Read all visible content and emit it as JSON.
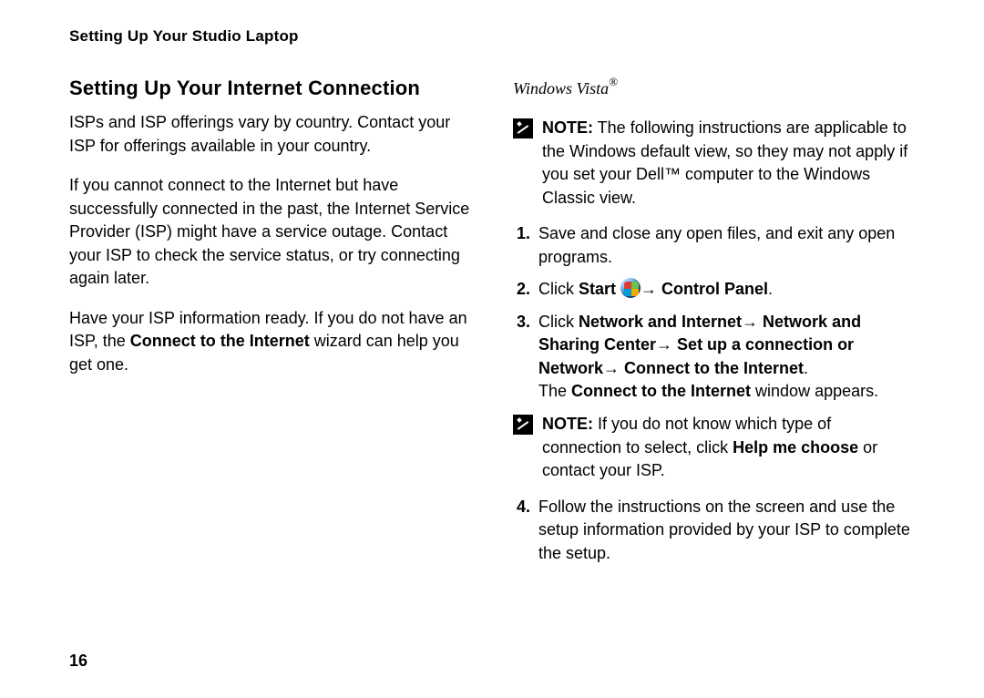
{
  "runningHead": "Setting Up Your Studio Laptop",
  "sectionTitle": "Setting Up Your Internet Connection",
  "leftCol": {
    "p1": "ISPs and ISP offerings vary by country. Contact your ISP for offerings available in your country.",
    "p2": "If you cannot connect to the Internet but have successfully connected in the past, the Internet Service Provider (ISP) might have a service outage. Contact your ISP to check the service status, or try connecting again later.",
    "p3_pre": "Have your ISP information ready. If you do not have an ISP, the ",
    "p3_bold": "Connect to the Internet",
    "p3_post": " wizard can help you get one."
  },
  "rightCol": {
    "osTitle": "Windows Vista",
    "osMark": "®",
    "note1_label": "NOTE:",
    "note1_text": " The following instructions are applicable to the Windows default view, so they may not apply if you set your Dell™ computer to the Windows Classic view.",
    "steps": {
      "s1_num": "1.",
      "s1_text": "Save and close any open files, and exit any open programs.",
      "s2_num": "2.",
      "s2_pre": "Click ",
      "s2_start": "Start ",
      "s2_arrow": "→ ",
      "s2_cp": "Control Panel",
      "s2_post": ".",
      "s3_num": "3.",
      "s3_pre": "Click ",
      "s3_b1": "Network and Internet",
      "s3_a1": "→ ",
      "s3_b2": "Network and Sharing Center",
      "s3_a2": "→ ",
      "s3_b3": "Set up a connection or Network",
      "s3_a3": "→ ",
      "s3_b4": "Connect to the Internet",
      "s3_post": ".",
      "s3_line2_pre": "The ",
      "s3_line2_bold": "Connect to the Internet",
      "s3_line2_post": " window appears.",
      "s4_num": "4.",
      "s4_text": "Follow the instructions on the screen and use the setup information provided by your ISP to complete the setup."
    },
    "note2_label": "NOTE:",
    "note2_pre": " If you do not know which type of connection to select, click ",
    "note2_bold": "Help me choose",
    "note2_post": " or contact your ISP."
  },
  "pageNumber": "16"
}
